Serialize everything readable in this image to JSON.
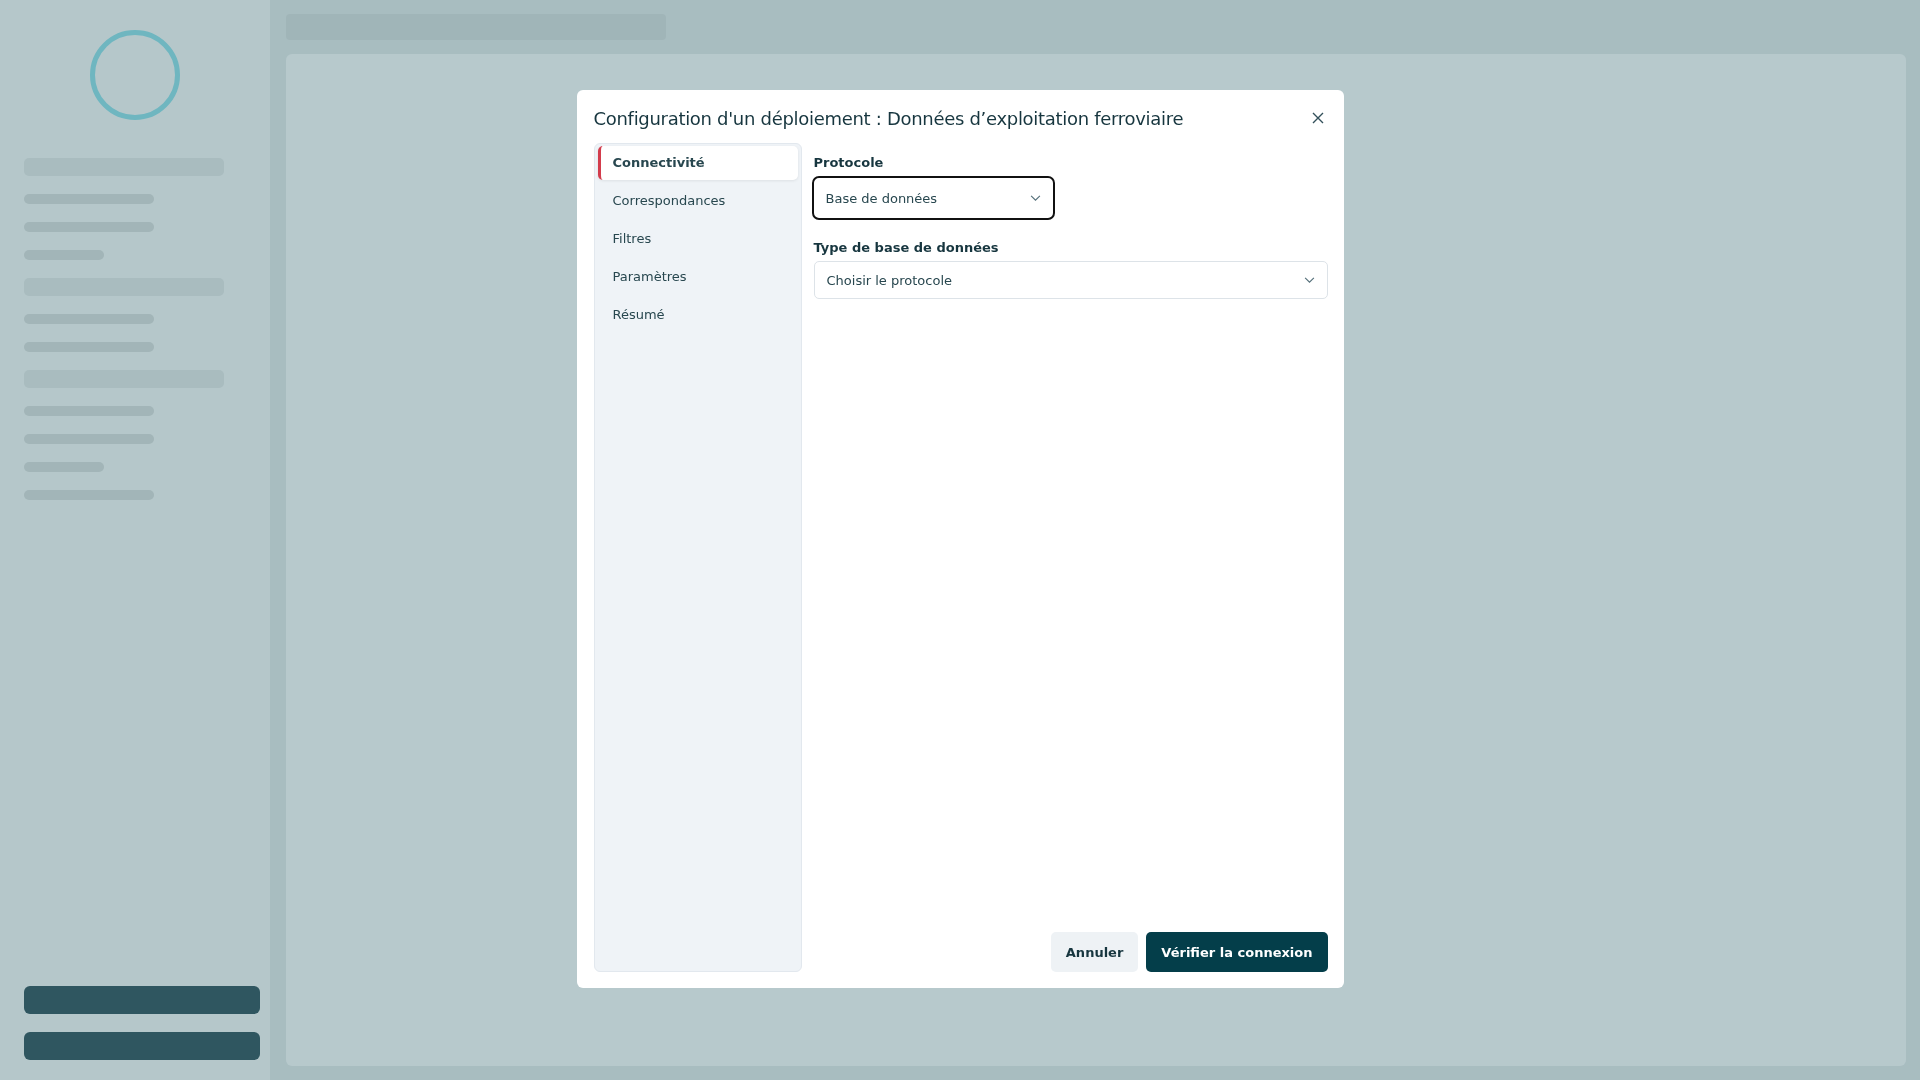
{
  "dialog": {
    "title": "Configuration d'un déploiement : Données d’exploitation ferroviaire",
    "steps": [
      {
        "label": "Connectivité",
        "selected": true
      },
      {
        "label": "Correspondances",
        "selected": false
      },
      {
        "label": "Filtres",
        "selected": false
      },
      {
        "label": "Paramètres",
        "selected": false
      },
      {
        "label": "Résumé",
        "selected": false
      }
    ],
    "fields": [
      {
        "label": "Protocole",
        "value": "Base de données",
        "focused": true
      },
      {
        "label": "Type de base de données",
        "placeholder": "Choisir le protocole",
        "focused": false
      }
    ],
    "buttons": [
      {
        "label": "Annuler",
        "kind": "secondary"
      },
      {
        "label": "Vérifier la connexion",
        "kind": "primary"
      }
    ]
  }
}
